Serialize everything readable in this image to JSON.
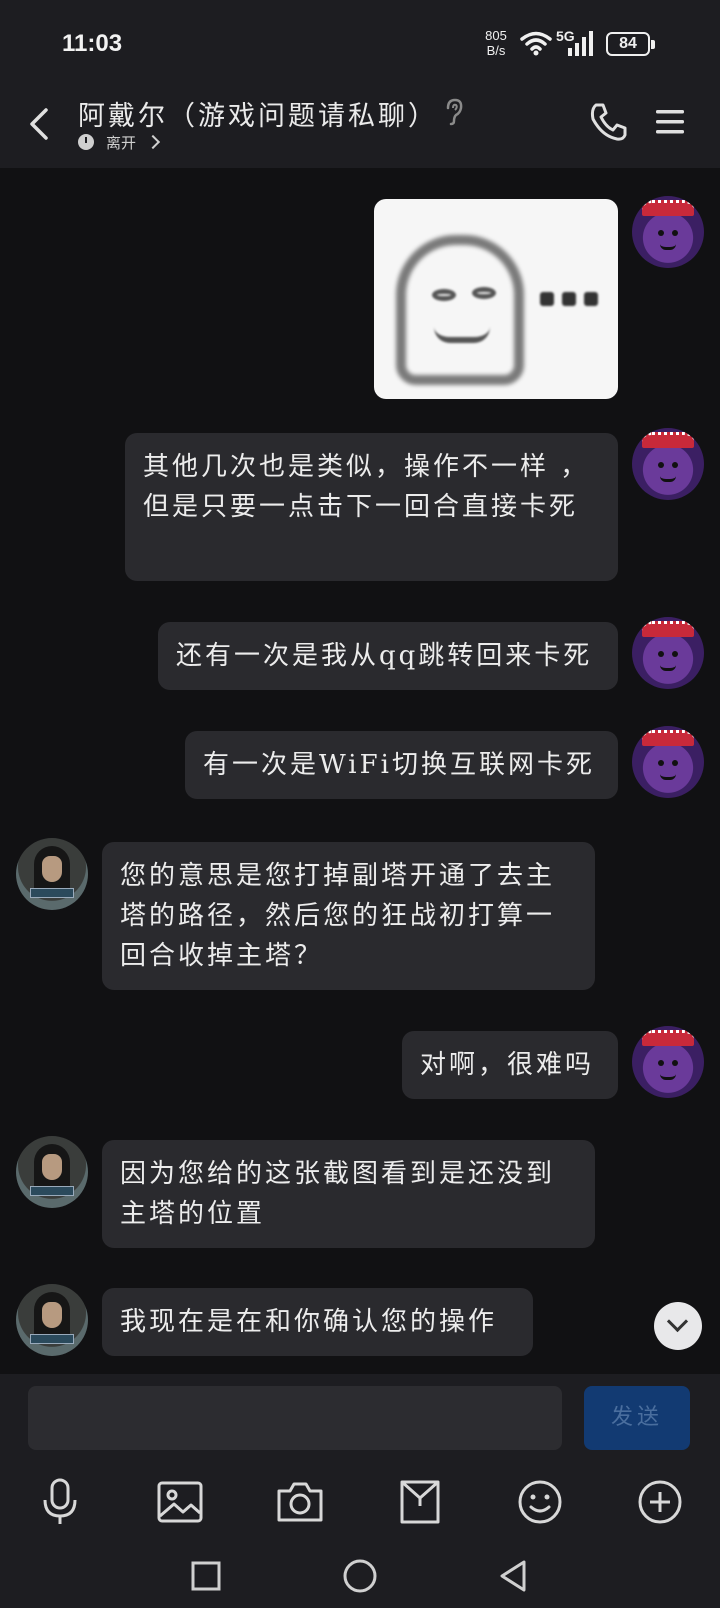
{
  "status_bar": {
    "time": "11:03",
    "net_speed_value": "805",
    "net_speed_unit": "B/s",
    "network": "5G",
    "battery": "84"
  },
  "header": {
    "title": "阿戴尔（游戏问题请私聊）",
    "status": "离开"
  },
  "messages": [
    {
      "side": "right",
      "kind": "image",
      "icon": "meme-face-image"
    },
    {
      "side": "right",
      "text": "其他几次也是类似，操作不一样 ，但是只要一点击下一回合直接卡死"
    },
    {
      "side": "right",
      "text": "还有一次是我从qq跳转回来卡死"
    },
    {
      "side": "right",
      "text": "有一次是WiFi切换互联网卡死"
    },
    {
      "side": "left",
      "text": "您的意思是您打掉副塔开通了去主塔的路径，然后您的狂战初打算一回合收掉主塔？"
    },
    {
      "side": "right",
      "text": "对啊，很难吗"
    },
    {
      "side": "left",
      "text": "因为您给的这张截图看到是还没到主塔的位置"
    },
    {
      "side": "left",
      "text": "我现在是在和你确认您的操作"
    }
  ],
  "input": {
    "value": "",
    "send_label": "发送"
  },
  "toolbar_icons": [
    "microphone-icon",
    "image-icon",
    "camera-icon",
    "folder-icon",
    "emoji-icon",
    "plus-icon"
  ],
  "nav_icons": [
    "recents-icon",
    "home-icon",
    "back-icon"
  ],
  "colors": {
    "background": "#111113",
    "bar": "#1d1d21",
    "bubble": "#2a2a2e",
    "send_button": "#123a72"
  }
}
